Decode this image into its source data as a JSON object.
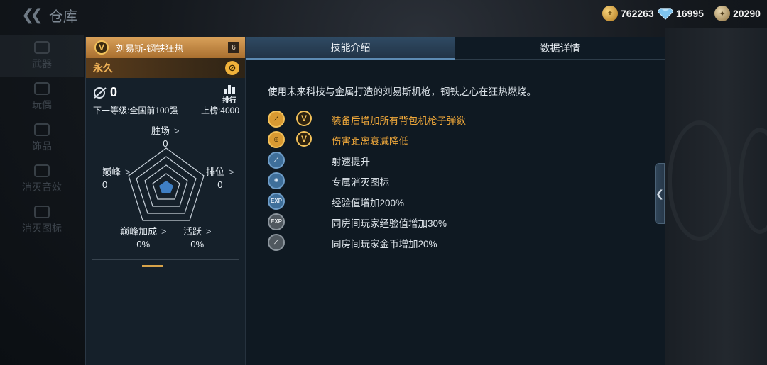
{
  "topbar": {
    "back_title": "仓库",
    "currencies": [
      {
        "icon": "gold-coin-plus-icon",
        "value": "762263"
      },
      {
        "icon": "diamond-icon",
        "value": "16995"
      },
      {
        "icon": "honor-coin-icon",
        "value": "20290"
      }
    ]
  },
  "side_nav": {
    "items": [
      {
        "label": "武器"
      },
      {
        "label": "玩偶"
      },
      {
        "label": "饰品"
      },
      {
        "label": "消灭音效"
      },
      {
        "label": "消灭图标"
      }
    ]
  },
  "weapon": {
    "badge": "V",
    "name": "刘易斯-钢铁狂热",
    "level": "6",
    "duration": "永久",
    "rank_value": "0",
    "ranking_label": "排行",
    "next_level": "下一等级:全国前100强",
    "on_board": "上榜:4000"
  },
  "stats": {
    "win": {
      "label": "胜场",
      "value": "0"
    },
    "rank": {
      "label": "排位",
      "value": "0"
    },
    "active": {
      "label": "活跃",
      "value": "0%"
    },
    "peak_bonus": {
      "label": "巅峰加成",
      "value": "0%"
    },
    "peak": {
      "label": "巅峰",
      "value": "0"
    }
  },
  "tabs": [
    {
      "label": "技能介绍",
      "active": true
    },
    {
      "label": "数据详情",
      "active": false
    }
  ],
  "description": "使用未来科技与金属打造的刘易斯机枪，钢铁之心在狂热燃烧。",
  "skills": [
    {
      "icon": "bullet-upgrade-icon",
      "style": "gold",
      "badge": "V",
      "text": "装备后增加所有背包机枪子弹数"
    },
    {
      "icon": "range-target-icon",
      "style": "gold",
      "badge": "V",
      "text": "伤害距离衰减降低"
    },
    {
      "icon": "fire-rate-icon",
      "style": "blue",
      "badge": "",
      "text": "射速提升"
    },
    {
      "icon": "kill-icon-emblem",
      "style": "blue",
      "badge": "",
      "text": "专属消灭图标"
    },
    {
      "icon": "exp-icon",
      "style": "blue",
      "badge": "",
      "text": "经验值增加200%"
    },
    {
      "icon": "room-exp-icon",
      "style": "grey",
      "badge": "",
      "text": "同房间玩家经验值增加30%"
    },
    {
      "icon": "room-gold-icon",
      "style": "grey",
      "badge": "",
      "text": "同房间玩家金币增加20%"
    }
  ],
  "colors": {
    "accent_gold": "#f0a83a",
    "tab_active": "#2f4a63",
    "panel_bg": "#0f1922"
  }
}
